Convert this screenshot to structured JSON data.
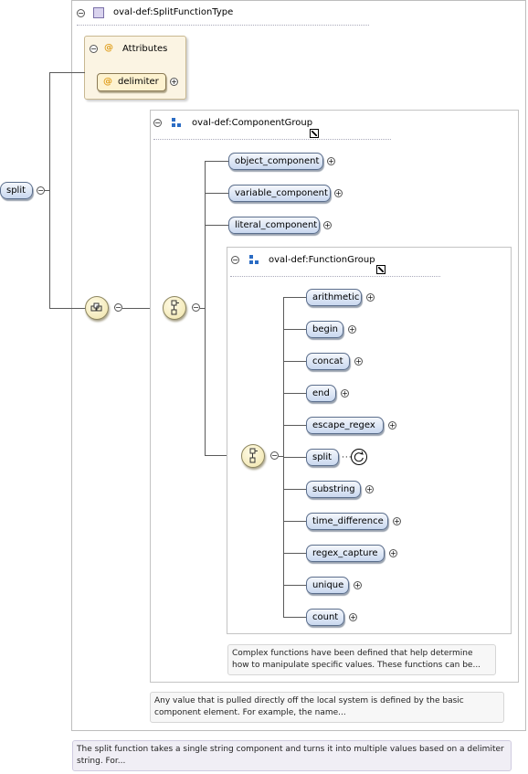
{
  "root_element": {
    "label": "split"
  },
  "split_function_type": {
    "title": "oval-def:SplitFunctionType"
  },
  "attributes": {
    "title": "Attributes",
    "items": [
      {
        "label": "delimiter"
      }
    ]
  },
  "component_group": {
    "title": "oval-def:ComponentGroup",
    "items": [
      {
        "label": "object_component"
      },
      {
        "label": "variable_component"
      },
      {
        "label": "literal_component"
      }
    ]
  },
  "function_group": {
    "title": "oval-def:FunctionGroup",
    "items": [
      {
        "label": "arithmetic"
      },
      {
        "label": "begin"
      },
      {
        "label": "concat"
      },
      {
        "label": "end"
      },
      {
        "label": "escape_regex"
      },
      {
        "label": "split"
      },
      {
        "label": "substring"
      },
      {
        "label": "time_difference"
      },
      {
        "label": "regex_capture"
      },
      {
        "label": "unique"
      },
      {
        "label": "count"
      }
    ]
  },
  "notes": {
    "function_group": "Complex functions have been defined that help determine how to manipulate specific values. These functions can be...",
    "component_group": "Any value that is pulled directly off the local system is defined by the basic component element. For example, the name...",
    "split": "The split function takes a single string component and turns it into multiple values based on a delimiter string. For..."
  },
  "colors": {
    "element_fill": "#c9d8ef",
    "attribute_fill": "#fdf2d0",
    "compositor_fill": "#efe3a8",
    "line": "#5a5a5a"
  }
}
